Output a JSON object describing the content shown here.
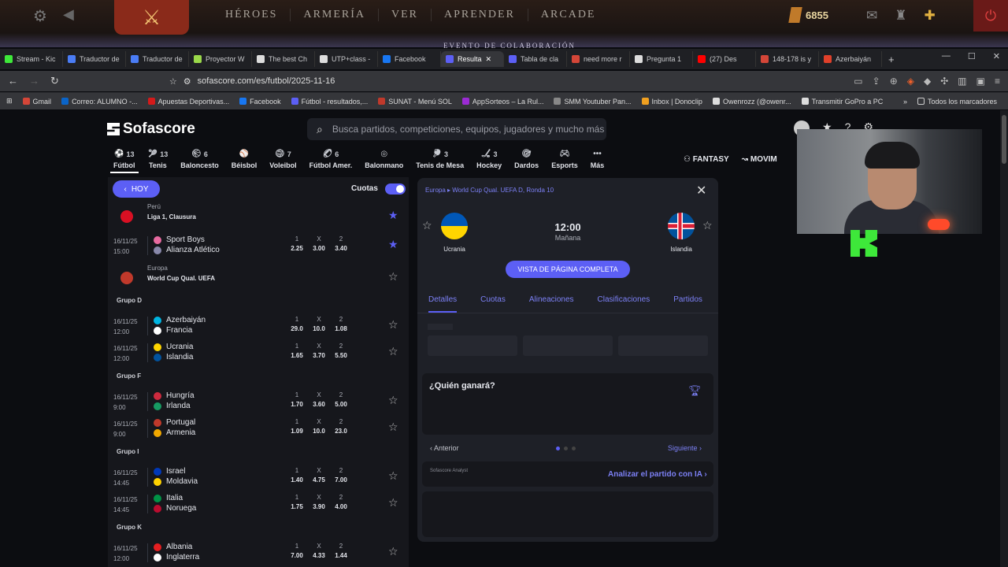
{
  "game_bar": {
    "nav": [
      "HÉROES",
      "ARMERÍA",
      "VER",
      "APRENDER",
      "ARCADE"
    ],
    "event": "EVENTO DE COLABORACIÓN",
    "gold": "6855",
    "icons": [
      "gear-icon",
      "back-icon",
      "mail-icon",
      "armor-icon",
      "plus-icon",
      "power-icon"
    ]
  },
  "browser": {
    "tabs": [
      {
        "title": "Stream - Kic",
        "color": "#3ee83a"
      },
      {
        "title": "Traductor de",
        "color": "#4a7cf5"
      },
      {
        "title": "Traductor de",
        "color": "#4a7cf5"
      },
      {
        "title": "Proyector W",
        "color": "#9ad84a"
      },
      {
        "title": "The best Ch",
        "color": "#dddddd"
      },
      {
        "title": "UTP+class -",
        "color": "#dddddd"
      },
      {
        "title": "Facebook",
        "color": "#1877f2"
      },
      {
        "title": "Resulta",
        "color": "#5c5ff5",
        "active": true
      },
      {
        "title": "Tabla de cla",
        "color": "#5c5ff5"
      },
      {
        "title": "need more r",
        "color": "#d44638"
      },
      {
        "title": "Pregunta 1",
        "color": "#dddddd"
      },
      {
        "title": "(27) Des",
        "color": "#ff0000"
      },
      {
        "title": "148-178 is y",
        "color": "#d44638"
      },
      {
        "title": "Azerbaiyán",
        "color": "#e0402a"
      }
    ],
    "url": "sofascore.com/es/futbol/2025-11-16",
    "bookmarks": [
      {
        "label": "Gmail",
        "color": "#d44638"
      },
      {
        "label": "Correo: ALUMNO -...",
        "color": "#0a64c8"
      },
      {
        "label": "Apuestas Deportivas...",
        "color": "#d41a1a"
      },
      {
        "label": "Facebook",
        "color": "#1877f2"
      },
      {
        "label": "Fútbol - resultados,...",
        "color": "#5c5ff5"
      },
      {
        "label": "SUNAT - Menú SOL",
        "color": "#c0392b"
      },
      {
        "label": "AppSorteos – La Rul...",
        "color": "#9b2bd4"
      },
      {
        "label": "SMM Youtuber Pan...",
        "color": "#888888"
      },
      {
        "label": "Inbox | Donoclip",
        "color": "#f0a020"
      },
      {
        "label": "Owenrozz (@owenr...",
        "color": "#dddddd"
      },
      {
        "label": "Transmitir GoPro a PC",
        "color": "#dddddd"
      }
    ],
    "all_bookmarks": "Todos los marcadores"
  },
  "site": {
    "brand": "Sofascore",
    "search_placeholder": "Busca partidos, competiciones, equipos, jugadores y mucho más",
    "sports": [
      {
        "name": "Fútbol",
        "count": "13",
        "active": true
      },
      {
        "name": "Tenis",
        "count": "13"
      },
      {
        "name": "Baloncesto",
        "count": "6"
      },
      {
        "name": "Béisbol",
        "count": ""
      },
      {
        "name": "Voleibol",
        "count": "7"
      },
      {
        "name": "Fútbol Amer.",
        "count": "6"
      },
      {
        "name": "Balonmano",
        "count": ""
      },
      {
        "name": "Tenis de Mesa",
        "count": "3"
      },
      {
        "name": "Hockey",
        "count": "3"
      },
      {
        "name": "Dardos",
        "count": ""
      },
      {
        "name": "Esports",
        "count": ""
      },
      {
        "name": "Más",
        "count": ""
      }
    ],
    "fantasy": "FANTASY",
    "moving": "MOVIM"
  },
  "list": {
    "hoy": "HOY",
    "odds_label": "Cuotas",
    "odds_on": true,
    "leagues": [
      {
        "country": "Perú",
        "name": "Liga 1, Clausura",
        "flag_color": "#d91023",
        "starred": true,
        "groups": [
          {
            "name": "",
            "matches": [
              {
                "date": "16/11/25",
                "time": "15:00",
                "home": "Sport Boys",
                "away": "Alianza Atlético",
                "o1": "2.25",
                "ox": "3.00",
                "o2": "3.40",
                "home_color": "#e86aa0",
                "away_color": "#8888aa",
                "starred": true
              }
            ]
          }
        ]
      },
      {
        "country": "Europa",
        "name": "World Cup Qual. UEFA",
        "flag_color": "#c0392b",
        "starred": false,
        "groups": [
          {
            "name": "Grupo D",
            "matches": [
              {
                "date": "16/11/25",
                "time": "12:00",
                "home": "Azerbaiyán",
                "away": "Francia",
                "o1": "29.0",
                "ox": "10.0",
                "o2": "1.08",
                "home_color": "#00b5e2",
                "away_color": "#ffffff"
              },
              {
                "date": "16/11/25",
                "time": "12:00",
                "home": "Ucrania",
                "away": "Islandia",
                "o1": "1.65",
                "ox": "3.70",
                "o2": "5.50",
                "home_color": "#ffd500",
                "away_color": "#02529c"
              }
            ]
          },
          {
            "name": "Grupo F",
            "matches": [
              {
                "date": "16/11/25",
                "time": "9:00",
                "home": "Hungría",
                "away": "Irlanda",
                "o1": "1.70",
                "ox": "3.60",
                "o2": "5.00",
                "home_color": "#cd2a3e",
                "away_color": "#169b62"
              },
              {
                "date": "16/11/25",
                "time": "9:00",
                "home": "Portugal",
                "away": "Armenia",
                "o1": "1.09",
                "ox": "10.0",
                "o2": "23.0",
                "home_color": "#c0392b",
                "away_color": "#f2a800"
              }
            ]
          },
          {
            "name": "Grupo I",
            "matches": [
              {
                "date": "16/11/25",
                "time": "14:45",
                "home": "Israel",
                "away": "Moldavia",
                "o1": "1.40",
                "ox": "4.75",
                "o2": "7.00",
                "home_color": "#0038b8",
                "away_color": "#ffd200"
              },
              {
                "date": "16/11/25",
                "time": "14:45",
                "home": "Italia",
                "away": "Noruega",
                "o1": "1.75",
                "ox": "3.90",
                "o2": "4.00",
                "home_color": "#009246",
                "away_color": "#ba0c2f"
              }
            ]
          },
          {
            "name": "Grupo K",
            "matches": [
              {
                "date": "16/11/25",
                "time": "12:00",
                "home": "Albania",
                "away": "Inglaterra",
                "o1": "7.00",
                "ox": "4.33",
                "o2": "1.44",
                "home_color": "#e41e20",
                "away_color": "#ffffff"
              }
            ]
          }
        ]
      }
    ],
    "col_labels": [
      "1",
      "X",
      "2"
    ]
  },
  "detail": {
    "crumb": "Europa ▸ World Cup Qual. UEFA D, Ronda 10",
    "home": "Ucrania",
    "away": "Islandia",
    "time": "12:00",
    "day": "Mañana",
    "full_page": "VISTA DE PÁGINA COMPLETA",
    "tabs": [
      "Detalles",
      "Cuotas",
      "Alineaciones",
      "Clasificaciones",
      "Partidos"
    ],
    "who_wins": "¿Quién ganará?",
    "prev": "Anterior",
    "next": "Siguiente",
    "analyst": "Sofascore Analyst",
    "analyze": "Analizar el partido con IA"
  }
}
